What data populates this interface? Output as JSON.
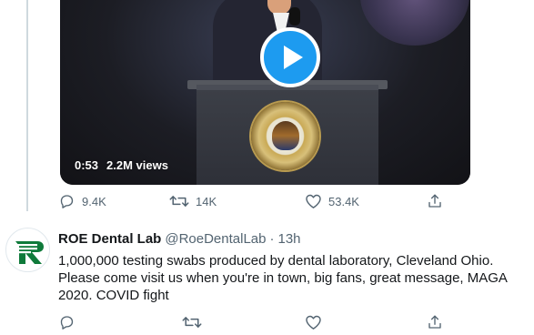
{
  "video": {
    "duration": "0:53",
    "views": "2.2M views"
  },
  "video_tweet_actions": {
    "replies": "9.4K",
    "retweets": "14K",
    "likes": "53.4K"
  },
  "tweet": {
    "display_name": "ROE Dental Lab",
    "handle": "@RoeDentalLab",
    "separator": "·",
    "time": "13h",
    "text": "1,000,000 testing swabs produced by dental laboratory, Cleveland Ohio. Please come visit us when you're in town, big fans, great message, MAGA 2020. COVID fight"
  },
  "colors": {
    "accent": "#1d9bf0",
    "icon_gray": "#536471",
    "logo_green": "#0f7a3a"
  },
  "icons": [
    "play-icon",
    "reply-icon",
    "retweet-icon",
    "like-icon",
    "share-icon"
  ]
}
